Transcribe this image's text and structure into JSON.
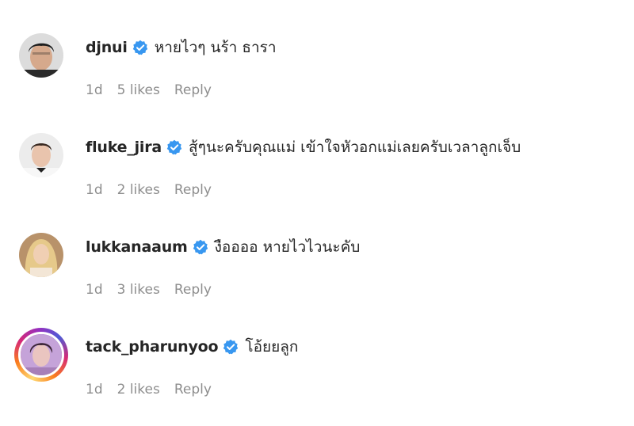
{
  "comments": [
    {
      "username": "djnui",
      "text": "หายไวๆ นร้า ธารา",
      "time": "1d",
      "likes": "5 likes",
      "reply": "Reply",
      "avatar": "person-dark-icon",
      "story_ring": false
    },
    {
      "username": "fluke_jira",
      "text": "สู้ๆนะครับคุณแม่ เข้าใจหัวอกแม่เลยครับเวลาลูกเจ็บ",
      "time": "1d",
      "likes": "2 likes",
      "reply": "Reply",
      "avatar": "person-light-icon",
      "story_ring": false
    },
    {
      "username": "lukkanaaum",
      "text": "งืออออ หายไวไวนะคับ",
      "time": "1d",
      "likes": "3 likes",
      "reply": "Reply",
      "avatar": "person-blonde-icon",
      "story_ring": false
    },
    {
      "username": "tack_pharunyoo",
      "text": "โอ้ยยลูก",
      "time": "1d",
      "likes": "2 likes",
      "reply": "Reply",
      "avatar": "person-purple-icon",
      "story_ring": true
    }
  ],
  "colors": {
    "verified_badge": "#3897f0",
    "meta_text": "#8e8e8e",
    "primary_text": "#262626"
  }
}
